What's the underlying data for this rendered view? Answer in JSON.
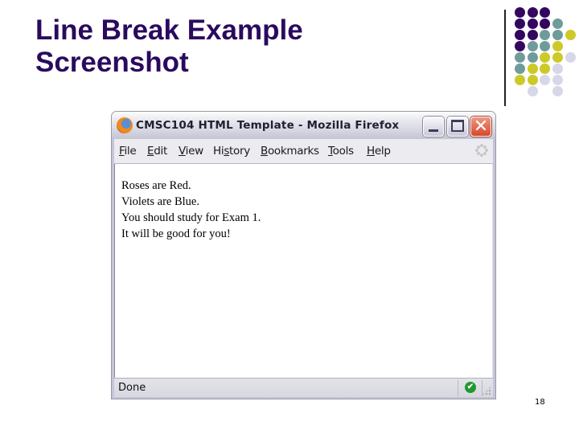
{
  "slide": {
    "title_line1": "Line Break Example",
    "title_line2": "Screenshot",
    "page_number": "18",
    "title_color": "#2a0a5e",
    "decoration_dot_colors": {
      "purple": "#33075f",
      "teal": "#6f9c9a",
      "yellow": "#cdc928",
      "lavender": "#d7d7e8"
    }
  },
  "window": {
    "title": "CMSC104 HTML Template - Mozilla Firefox",
    "icon": "firefox-logo-icon",
    "controls": {
      "minimize": "minimize-icon",
      "maximize": "maximize-icon",
      "close": "close-icon",
      "close_glyph": "✕"
    },
    "menu": [
      {
        "pre": "",
        "mnemonic": "F",
        "post": "ile"
      },
      {
        "pre": "",
        "mnemonic": "E",
        "post": "dit"
      },
      {
        "pre": "",
        "mnemonic": "V",
        "post": "iew"
      },
      {
        "pre": "Hi",
        "mnemonic": "s",
        "post": "tory"
      },
      {
        "pre": "",
        "mnemonic": "B",
        "post": "ookmarks"
      },
      {
        "pre": "",
        "mnemonic": "T",
        "post": "ools"
      },
      {
        "pre": "",
        "mnemonic": "H",
        "post": "elp"
      }
    ],
    "throbber_icon": "activity-throbber-icon",
    "content_lines": [
      "Roses are Red.",
      "Violets are Blue.",
      "You should study for Exam 1.",
      "It will be good for you!"
    ],
    "status": {
      "text": "Done",
      "security_icon": "check-circle-icon",
      "security_glyph": "✔"
    }
  }
}
